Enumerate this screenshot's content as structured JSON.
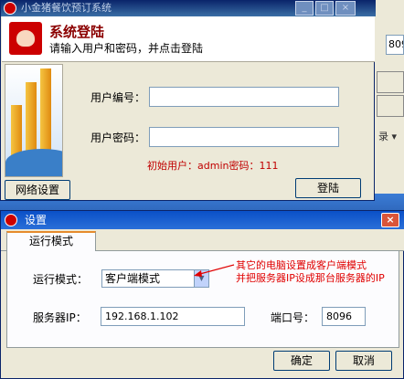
{
  "background_app": {
    "field_value": "809",
    "chevron_text": "录 ▾"
  },
  "login_window": {
    "title": "小金猪餐饮预订系统",
    "header_title": "系统登陆",
    "header_subtitle": "请输入用户和密码，并点击登陆",
    "user_label": "用户编号：",
    "user_value": "",
    "password_label": "用户密码：",
    "password_value": "",
    "hint": "初始用户：admin密码：111",
    "network_button": "网络设置",
    "login_button": "登陆",
    "controls": {
      "minimize": "_",
      "maximize": "□",
      "close": "×"
    }
  },
  "settings_window": {
    "title": "设置",
    "close": "×",
    "tab": "运行模式",
    "mode_label": "运行模式：",
    "mode_value": "客户端模式",
    "server_ip_label": "服务器IP：",
    "server_ip_value": "192.168.1.102",
    "port_label": "端口号：",
    "port_value": "8096",
    "ok_button": "确定",
    "cancel_button": "取消"
  },
  "annotation": {
    "line1": "其它的电脑设置成客户端模式",
    "line2": "并把服务器IP设成那台服务器的IP",
    "color": "#e00000"
  },
  "colors": {
    "title_bar_inactive": "#0a246a",
    "title_bar_active": "#0a50c8",
    "dialog_bg": "#ece9d8",
    "hint_red": "#c00000"
  }
}
